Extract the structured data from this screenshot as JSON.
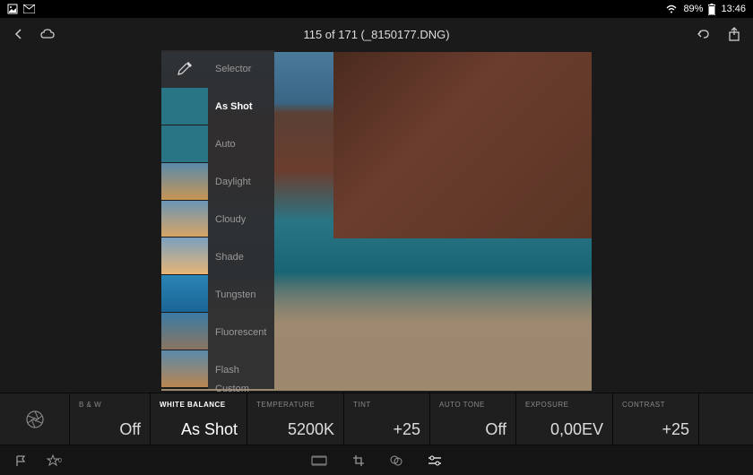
{
  "status": {
    "battery": "89%",
    "time": "13:46"
  },
  "header": {
    "title": "115 of 171 (_8150177.DNG)"
  },
  "wb_options": [
    {
      "label": "Selector"
    },
    {
      "label": "As Shot",
      "selected": true
    },
    {
      "label": "Auto"
    },
    {
      "label": "Daylight"
    },
    {
      "label": "Cloudy"
    },
    {
      "label": "Shade"
    },
    {
      "label": "Tungsten"
    },
    {
      "label": "Fluorescent"
    },
    {
      "label": "Flash"
    },
    {
      "label": "Custom"
    }
  ],
  "params": [
    {
      "label": "B & W",
      "value": "Off",
      "width": 90
    },
    {
      "label": "WHITE BALANCE",
      "value": "As Shot",
      "width": 108,
      "active": true
    },
    {
      "label": "TEMPERATURE",
      "value": "5200K",
      "width": 108
    },
    {
      "label": "TINT",
      "value": "+25",
      "width": 96
    },
    {
      "label": "AUTO TONE",
      "value": "Off",
      "width": 96
    },
    {
      "label": "EXPOSURE",
      "value": "0,00EV",
      "width": 108
    },
    {
      "label": "CONTRAST",
      "value": "+25",
      "width": 96
    }
  ]
}
